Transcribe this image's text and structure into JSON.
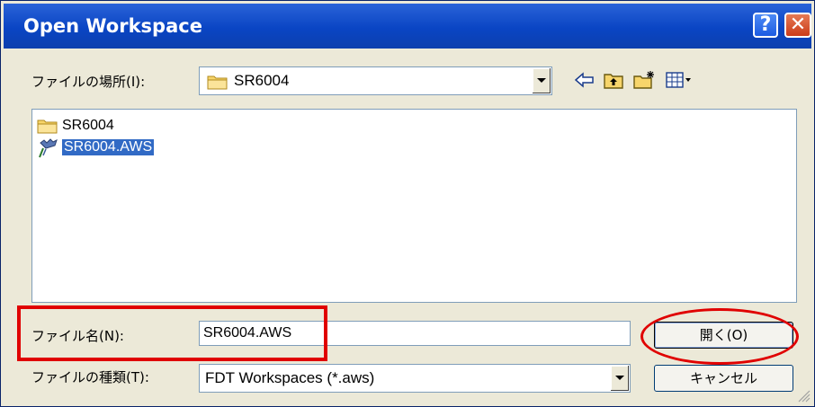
{
  "window": {
    "title": "Open Workspace",
    "help_glyph": "?",
    "close_glyph": "✕"
  },
  "look_in": {
    "label": "ファイルの場所(I):",
    "value": "SR6004"
  },
  "toolbar": {
    "icons": [
      "back-arrow-icon",
      "up-folder-icon",
      "new-folder-icon",
      "view-menu-icon"
    ]
  },
  "file_list": [
    {
      "name": "SR6004",
      "icon": "folder-icon",
      "selected": false
    },
    {
      "name": "SR6004.AWS",
      "icon": "workspace-file-icon",
      "selected": true
    }
  ],
  "file_name": {
    "label": "ファイル名(N):",
    "value": "SR6004.AWS"
  },
  "file_type": {
    "label": "ファイルの種類(T):",
    "value": "FDT Workspaces (*.aws)"
  },
  "buttons": {
    "open": "開く(O)",
    "cancel": "キャンセル"
  },
  "colors": {
    "titlebar": "#0a45c4",
    "dialog_bg": "#ece9d8",
    "selection": "#316ac5",
    "annotation": "#e00000"
  }
}
